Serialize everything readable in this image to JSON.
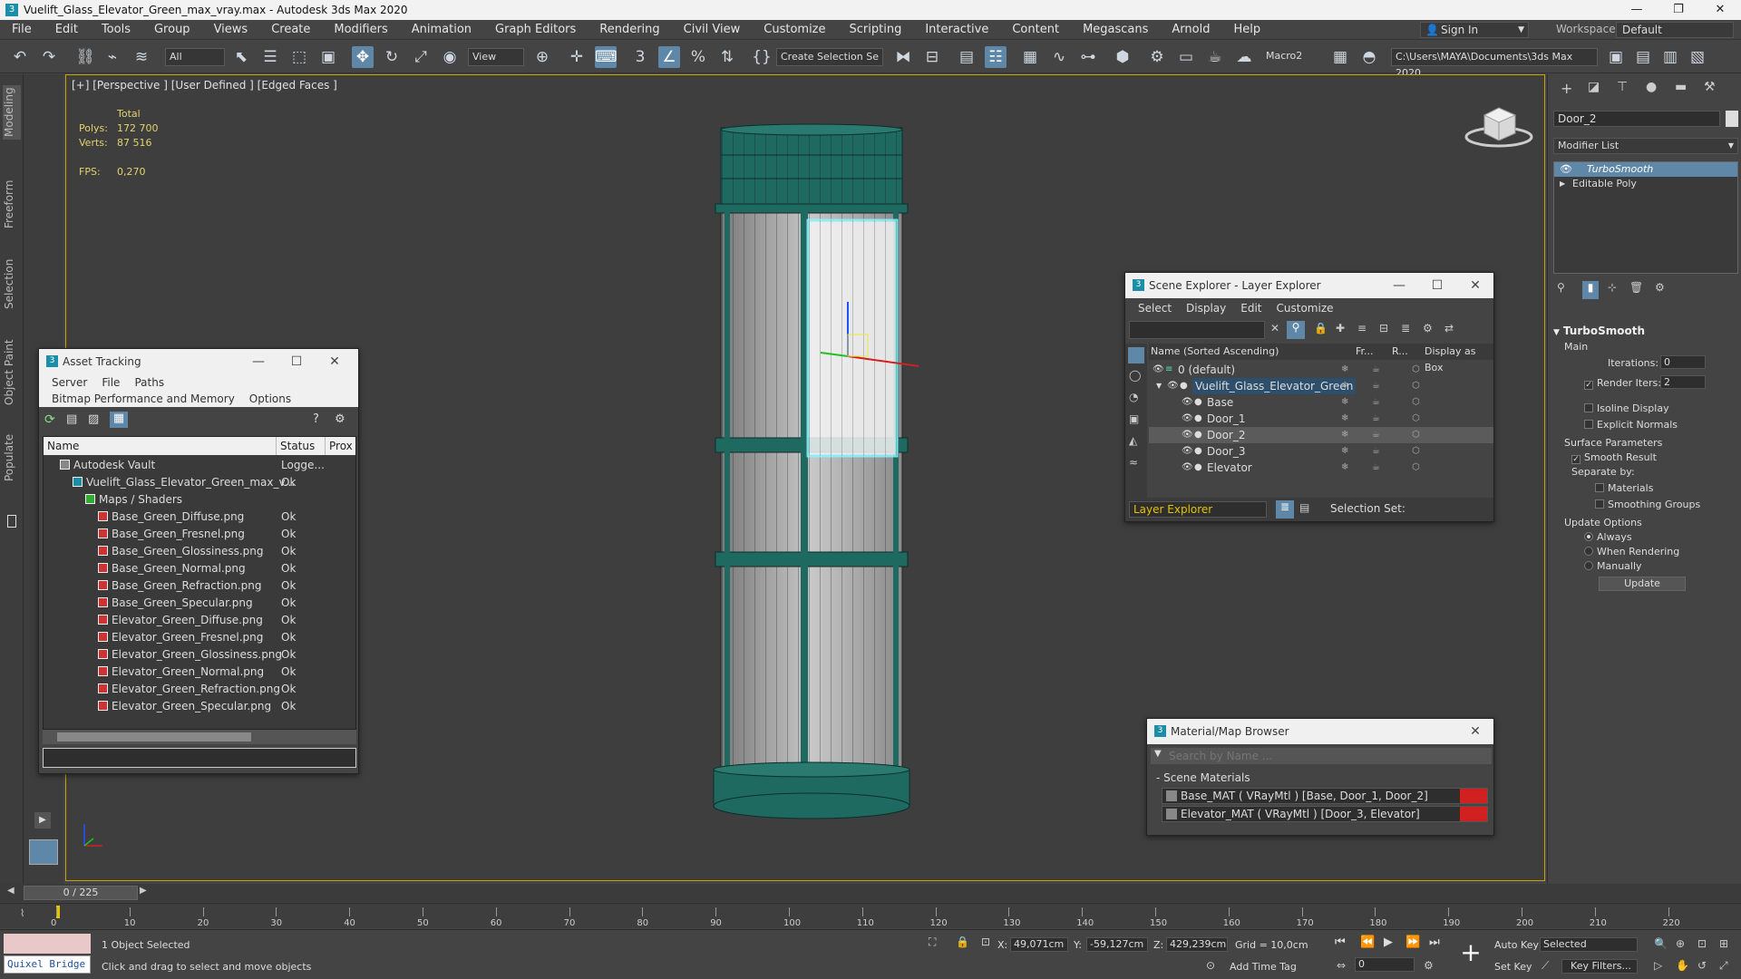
{
  "window": {
    "title": "Vuelift_Glass_Elevator_Green_max_vray.max - Autodesk 3ds Max 2020"
  },
  "menu": [
    "File",
    "Edit",
    "Tools",
    "Group",
    "Views",
    "Create",
    "Modifiers",
    "Animation",
    "Graph Editors",
    "Rendering",
    "Civil View",
    "Customize",
    "Scripting",
    "Interactive",
    "Content",
    "Megascans",
    "Arnold",
    "Help"
  ],
  "account": {
    "signin": "Sign In",
    "workspaces_label": "Workspaces:",
    "workspace": "Default"
  },
  "toolbar": {
    "selection_filter": "All",
    "ref_coord": "View",
    "create_selection_set": "Create Selection Se",
    "macro": "Macro2",
    "project_path": "C:\\Users\\MAYA\\Documents\\3ds Max 2020"
  },
  "left_tabs": [
    "Modeling",
    "Freeform",
    "Selection",
    "Object Paint",
    "Populate"
  ],
  "viewport": {
    "label": "[+] [Perspective ] [User Defined ] [Edged Faces ]",
    "stats": {
      "total_label": "Total",
      "polys_label": "Polys:",
      "polys": "172 700",
      "verts_label": "Verts:",
      "verts": "87 516",
      "fps_label": "FPS:",
      "fps": "0,270"
    }
  },
  "asset_tracking": {
    "title": "Asset Tracking",
    "menu": [
      "Server",
      "File",
      "Paths",
      "Bitmap Performance and Memory",
      "Options"
    ],
    "columns": [
      "Name",
      "Status",
      "Prox"
    ],
    "rows": [
      {
        "name": "Autodesk Vault",
        "status": "Logge...",
        "level": 0
      },
      {
        "name": "Vuelift_Glass_Elevator_Green_max_v...",
        "status": "Ok",
        "level": 1
      },
      {
        "name": "Maps / Shaders",
        "status": "",
        "level": 2
      },
      {
        "name": "Base_Green_Diffuse.png",
        "status": "Ok",
        "level": 3
      },
      {
        "name": "Base_Green_Fresnel.png",
        "status": "Ok",
        "level": 3
      },
      {
        "name": "Base_Green_Glossiness.png",
        "status": "Ok",
        "level": 3
      },
      {
        "name": "Base_Green_Normal.png",
        "status": "Ok",
        "level": 3
      },
      {
        "name": "Base_Green_Refraction.png",
        "status": "Ok",
        "level": 3
      },
      {
        "name": "Base_Green_Specular.png",
        "status": "Ok",
        "level": 3
      },
      {
        "name": "Elevator_Green_Diffuse.png",
        "status": "Ok",
        "level": 3
      },
      {
        "name": "Elevator_Green_Fresnel.png",
        "status": "Ok",
        "level": 3
      },
      {
        "name": "Elevator_Green_Glossiness.png",
        "status": "Ok",
        "level": 3
      },
      {
        "name": "Elevator_Green_Normal.png",
        "status": "Ok",
        "level": 3
      },
      {
        "name": "Elevator_Green_Refraction.png",
        "status": "Ok",
        "level": 3
      },
      {
        "name": "Elevator_Green_Specular.png",
        "status": "Ok",
        "level": 3
      }
    ]
  },
  "scene_explorer": {
    "title": "Scene Explorer - Layer Explorer",
    "menu": [
      "Select",
      "Display",
      "Edit",
      "Customize"
    ],
    "columns": [
      "Name (Sorted Ascending)",
      "Fr...",
      "R...",
      "Display as Box"
    ],
    "rows": [
      {
        "name": "0 (default)",
        "level": 0,
        "selected": false
      },
      {
        "name": "Vuelift_Glass_Elevator_Green",
        "level": 1,
        "selected": false
      },
      {
        "name": "Base",
        "level": 2,
        "selected": false
      },
      {
        "name": "Door_1",
        "level": 2,
        "selected": false
      },
      {
        "name": "Door_2",
        "level": 2,
        "selected": true
      },
      {
        "name": "Door_3",
        "level": 2,
        "selected": false
      },
      {
        "name": "Elevator",
        "level": 2,
        "selected": false
      }
    ],
    "footer_dropdown": "Layer Explorer",
    "selection_set_label": "Selection Set:"
  },
  "material_browser": {
    "title": "Material/Map Browser",
    "search_placeholder": "Search by Name ...",
    "section": "Scene Materials",
    "items": [
      "Base_MAT ( VRayMtl ) [Base, Door_1, Door_2]",
      "Elevator_MAT ( VRayMtl ) [Door_3, Elevator]"
    ]
  },
  "command_panel": {
    "object_name": "Door_2",
    "modifier_list": "Modifier List",
    "stack": [
      "TurboSmooth",
      "Editable Poly"
    ],
    "rollout_title": "TurboSmooth",
    "main_label": "Main",
    "iterations_label": "Iterations:",
    "iterations": "0",
    "render_iters_label": "Render Iters:",
    "render_iters": "2",
    "isoline_label": "Isoline Display",
    "explicit_normals_label": "Explicit Normals",
    "surface_params_label": "Surface Parameters",
    "smooth_result_label": "Smooth Result",
    "separate_by_label": "Separate by:",
    "materials_label": "Materials",
    "smoothing_groups_label": "Smoothing Groups",
    "update_options_label": "Update Options",
    "always_label": "Always",
    "when_rendering_label": "When Rendering",
    "manually_label": "Manually",
    "update_button": "Update"
  },
  "timeline": {
    "frame_display": "0 / 225",
    "ticks": [
      "0",
      "10",
      "20",
      "30",
      "40",
      "50",
      "60",
      "70",
      "80",
      "90",
      "100",
      "110",
      "120",
      "130",
      "140",
      "150",
      "160",
      "170",
      "180",
      "190",
      "200",
      "210",
      "220"
    ]
  },
  "status": {
    "quixel": "Quixel Bridge",
    "selected": "1 Object Selected",
    "prompt": "Click and drag to select and move objects",
    "x_label": "X:",
    "x": "49,071cm",
    "y_label": "Y:",
    "y": "-59,127cm",
    "z_label": "Z:",
    "z": "429,239cm",
    "grid": "Grid = 10,0cm",
    "add_time_tag": "Add Time Tag",
    "auto_key": "Auto Key",
    "key_mode": "Selected",
    "set_key": "Set Key",
    "key_filters": "Key Filters...",
    "frame": "0"
  },
  "colors": {
    "accent": "#5e87a8",
    "teal": "#1f6a60",
    "viewport_border": "#c7a500",
    "stats": "#e4d26a"
  }
}
